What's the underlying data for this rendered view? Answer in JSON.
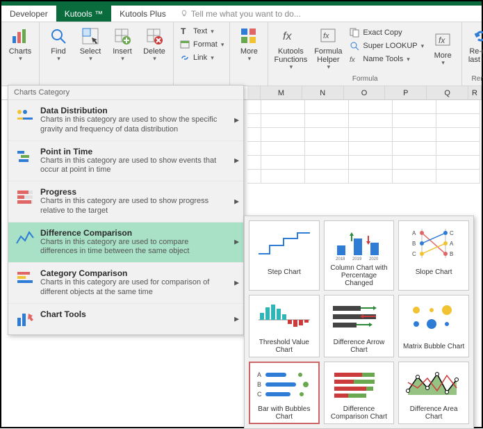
{
  "tabs": {
    "developer": "Developer",
    "kutools": "Kutools ™",
    "kutools_plus": "Kutools Plus"
  },
  "tell_me": "Tell me what you want to do...",
  "ribbon": {
    "charts": "Charts",
    "find": "Find",
    "select": "Select",
    "insert": "Insert",
    "delete": "Delete",
    "text": "Text",
    "format_menu": "Format",
    "link": "Link",
    "more": "More",
    "kutools_functions": "Kutools Functions",
    "formula_helper": "Formula Helper",
    "exact_copy": "Exact Copy",
    "super_lookup": "Super LOOKUP",
    "name_tools": "Name Tools",
    "more2": "More",
    "rerun": "Re-run last utili",
    "group_formula": "Formula",
    "group_rerun": "Rerun"
  },
  "columns": [
    "M",
    "N",
    "O",
    "P",
    "Q",
    "R"
  ],
  "dropdown": {
    "header": "Charts Category",
    "items": [
      {
        "title": "Data Distribution",
        "desc": "Charts in this category are used to show the specific gravity and frequency of data distribution"
      },
      {
        "title": "Point in Time",
        "desc": "Charts in this category are used to show events that occur at point in time"
      },
      {
        "title": "Progress",
        "desc": "Charts in this category are used to show progress relative to the target"
      },
      {
        "title": "Difference Comparison",
        "desc": "Charts in this category are used to compare differences in time between the same object"
      },
      {
        "title": "Category Comparison",
        "desc": "Charts in this category are used for comparison of different objects at the same time"
      },
      {
        "title": "Chart Tools",
        "desc": ""
      }
    ]
  },
  "gallery": {
    "items": [
      "Step Chart",
      "Column Chart with Percentage Changed",
      "Slope Chart",
      "Threshold Value Chart",
      "Difference Arrow Chart",
      "Matrix Bubble Chart",
      "Bar with Bubbles Chart",
      "Difference Comparison Chart",
      "Difference Area Chart"
    ],
    "slope_letters": {
      "a": "A",
      "b": "B",
      "c": "C"
    },
    "col_years": {
      "y1": "2018",
      "y2": "2019",
      "y3": "2020"
    }
  }
}
